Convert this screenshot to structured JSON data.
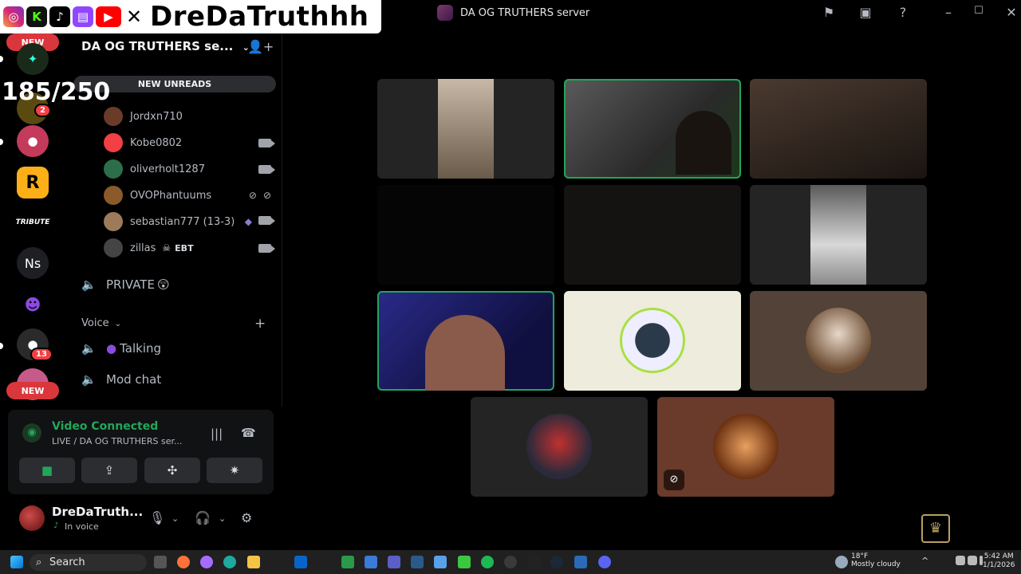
{
  "overlay": {
    "handle": "DreDaTruthhh",
    "counter": "185/250",
    "icons": [
      "instagram-icon",
      "kick-icon",
      "tiktok-icon",
      "twitch-icon",
      "youtube-icon",
      "x-icon"
    ]
  },
  "titlebar": {
    "title": "DA OG TRUTHERS server"
  },
  "rail": {
    "new_top": "NEW",
    "new_bottom": "NEW",
    "badge_2": "2",
    "badge_13": "13",
    "ns_label": "Ns",
    "tribute_label": "TRIBUTE"
  },
  "sidebar": {
    "server_name": "DA OG TRUTHERS se...",
    "new_unreads": "NEW UNREADS",
    "users": [
      {
        "name": "Jordxn710",
        "color": "#6b3b2a"
      },
      {
        "name": "Kobe0802",
        "color": "#f23f43"
      },
      {
        "name": "oliverholt1287",
        "color": "#2c6e49"
      },
      {
        "name": "OVOPhantuums",
        "color": "#8a5a2b"
      },
      {
        "name": "sebastian777 (13-3)",
        "color": "#9c7a5a"
      },
      {
        "name": "zillas",
        "tag": "EBT",
        "color": "#444"
      }
    ],
    "private_channel": "PRIVATE",
    "voice_category": "Voice",
    "talking_channel": "Talking",
    "mod_channel": "Mod chat"
  },
  "voice_panel": {
    "status": "Video Connected",
    "subtitle": "LIVE / DA OG TRUTHERS ser..."
  },
  "user_panel": {
    "name": "DreDaTruth...",
    "status": "In voice"
  },
  "taskbar": {
    "search": "Search",
    "weather_temp": "18°F",
    "weather_desc": "Mostly cloudy",
    "time": "5:42 AM",
    "date": "1/1/2026"
  },
  "colors": {
    "speaking": "#23a55a",
    "connected": "#23a55a",
    "badge": "#f23f43"
  }
}
